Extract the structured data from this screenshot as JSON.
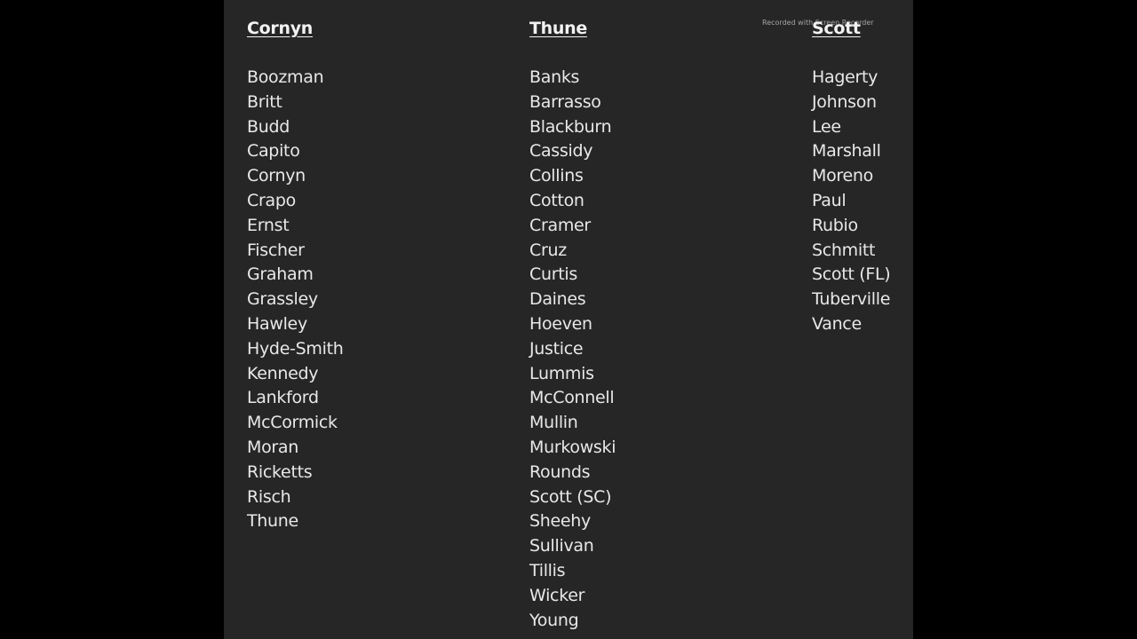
{
  "watermark": "Recorded with Screen Recorder",
  "columns": [
    {
      "header": "Cornyn",
      "names": [
        "Boozman",
        "Britt",
        "Budd",
        "Capito",
        "Cornyn",
        "Crapo",
        "Ernst",
        "Fischer",
        "Graham",
        "Grassley",
        "Hawley",
        "Hyde-Smith",
        "Kennedy",
        "Lankford",
        "McCormick",
        "Moran",
        "Ricketts",
        "Risch",
        "Thune"
      ]
    },
    {
      "header": "Thune",
      "names": [
        "Banks",
        "Barrasso",
        "Blackburn",
        "Cassidy",
        "Collins",
        "Cotton",
        "Cramer",
        "Cruz",
        "Curtis",
        "Daines",
        "Hoeven",
        "Justice",
        "Lummis",
        "McConnell",
        "Mullin",
        "Murkowski",
        "Rounds",
        "Scott (SC)",
        "Sheehy",
        "Sullivan",
        "Tillis",
        "Wicker",
        "Young"
      ]
    },
    {
      "header": "Scott",
      "names": [
        "Hagerty",
        "Johnson",
        "Lee",
        "Marshall",
        "Moreno",
        "Paul",
        "Rubio",
        "Schmitt",
        "Scott (FL)",
        "Tuberville",
        "Vance"
      ]
    }
  ]
}
